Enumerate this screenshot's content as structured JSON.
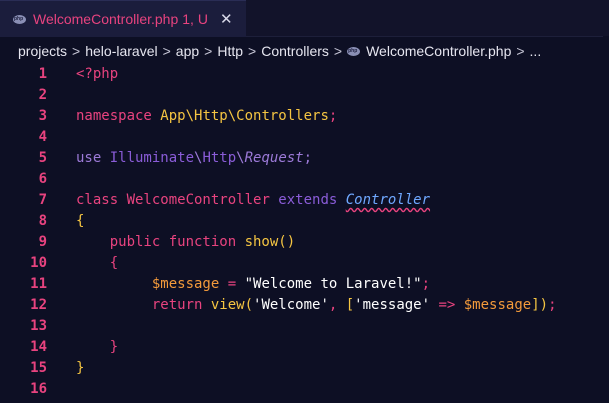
{
  "tab": {
    "filename": "WelcomeController.php",
    "status": "1, U",
    "close_glyph": "✕"
  },
  "breadcrumb": {
    "items": [
      "projects",
      "helo-laravel",
      "app",
      "Http",
      "Controllers",
      "WelcomeController.php",
      "..."
    ],
    "separator": ">"
  },
  "editor": {
    "lines": [
      {
        "n": "1",
        "segments": [
          {
            "c": "t-kw",
            "t": "<?php"
          }
        ]
      },
      {
        "n": "2",
        "segments": []
      },
      {
        "n": "3",
        "segments": [
          {
            "c": "t-kw",
            "t": "namespace "
          },
          {
            "c": "t-ns",
            "t": "App\\Http\\Controllers"
          },
          {
            "c": "t-kw",
            "t": ";"
          }
        ]
      },
      {
        "n": "4",
        "segments": []
      },
      {
        "n": "5",
        "segments": [
          {
            "c": "t-dim",
            "t": "use "
          },
          {
            "c": "t-use",
            "t": "Illuminate"
          },
          {
            "c": "t-dim",
            "t": "\\"
          },
          {
            "c": "t-use",
            "t": "Http"
          },
          {
            "c": "t-dim",
            "t": "\\"
          },
          {
            "c": "t-dim t-italic",
            "t": "Request"
          },
          {
            "c": "t-dim",
            "t": ";"
          }
        ]
      },
      {
        "n": "6",
        "segments": []
      },
      {
        "n": "7",
        "segments": [
          {
            "c": "t-kw",
            "t": "class "
          },
          {
            "c": "t-cls",
            "t": "WelcomeController "
          },
          {
            "c": "t-use",
            "t": "extends "
          },
          {
            "c": "t-ital squiggle",
            "t": "Controller"
          }
        ]
      },
      {
        "n": "8",
        "segments": [
          {
            "c": "t-punc",
            "t": "{"
          }
        ]
      },
      {
        "n": "9",
        "segments": [
          {
            "c": "t-kw",
            "t": "    public function "
          },
          {
            "c": "t-fn",
            "t": "show"
          },
          {
            "c": "t-punc",
            "t": "()"
          }
        ]
      },
      {
        "n": "10",
        "segments": [
          {
            "c": "t-kw",
            "t": "    {"
          }
        ]
      },
      {
        "n": "11",
        "segments": [
          {
            "c": "t-var",
            "t": "         $message"
          },
          {
            "c": "t-op",
            "t": " = "
          },
          {
            "c": "t-str",
            "t": "\"Welcome to Laravel!\""
          },
          {
            "c": "t-kw",
            "t": ";"
          }
        ]
      },
      {
        "n": "12",
        "segments": [
          {
            "c": "t-kw",
            "t": "         return "
          },
          {
            "c": "t-fn",
            "t": "view"
          },
          {
            "c": "t-punc",
            "t": "("
          },
          {
            "c": "t-str",
            "t": "'Welcome'"
          },
          {
            "c": "t-kw",
            "t": ", "
          },
          {
            "c": "t-punc",
            "t": "["
          },
          {
            "c": "t-str",
            "t": "'message'"
          },
          {
            "c": "t-op",
            "t": " => "
          },
          {
            "c": "t-var",
            "t": "$message"
          },
          {
            "c": "t-punc",
            "t": "]"
          },
          {
            "c": "t-punc",
            "t": ")"
          },
          {
            "c": "t-kw",
            "t": ";"
          }
        ]
      },
      {
        "n": "13",
        "segments": []
      },
      {
        "n": "14",
        "segments": [
          {
            "c": "t-kw",
            "t": "    }"
          }
        ]
      },
      {
        "n": "15",
        "segments": [
          {
            "c": "t-punc",
            "t": "}"
          }
        ]
      },
      {
        "n": "16",
        "segments": []
      }
    ]
  }
}
